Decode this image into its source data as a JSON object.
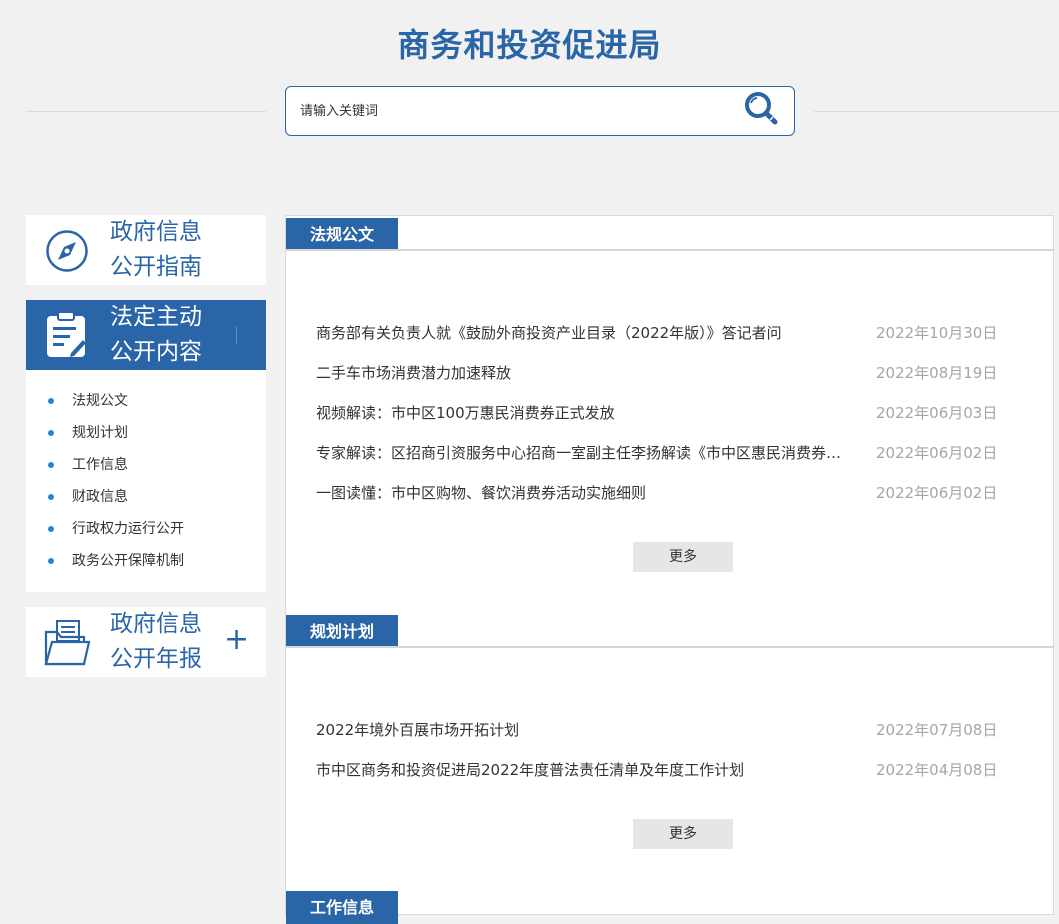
{
  "header": {
    "title": "商务和投资促进局"
  },
  "search": {
    "placeholder": "请输入关键词",
    "button_icon": "search-magnifier-icon"
  },
  "sidebar": {
    "guide": {
      "line1": "政府信息",
      "line2": "公开指南",
      "icon": "compass-icon"
    },
    "content": {
      "line1": "法定主动",
      "line2": "公开内容",
      "icon": "clipboard-icon"
    },
    "submenu": [
      {
        "label": "法规公文"
      },
      {
        "label": "规划计划"
      },
      {
        "label": "工作信息"
      },
      {
        "label": "财政信息"
      },
      {
        "label": "行政权力运行公开"
      },
      {
        "label": "政务公开保障机制"
      }
    ],
    "annual": {
      "line1": "政府信息",
      "line2": "公开年报",
      "icon": "folder-icon",
      "expand": "+"
    }
  },
  "sections": [
    {
      "tab": "法规公文",
      "items": [
        {
          "title": "商务部有关负责人就《鼓励外商投资产业目录（2022年版）》答记者问",
          "date": "2022年10月30日"
        },
        {
          "title": "二手车市场消费潜力加速释放",
          "date": "2022年08月19日"
        },
        {
          "title": "视频解读：市中区100万惠民消费券正式发放",
          "date": "2022年06月03日"
        },
        {
          "title": "专家解读：区招商引资服务中心招商一室副主任李扬解读《市中区惠民消费券活动实施细则》",
          "date": "2022年06月02日"
        },
        {
          "title": "一图读懂：市中区购物、餐饮消费券活动实施细则",
          "date": "2022年06月02日"
        }
      ],
      "more": "更多"
    },
    {
      "tab": "规划计划",
      "items": [
        {
          "title": "2022年境外百展市场开拓计划",
          "date": "2022年07月08日"
        },
        {
          "title": "市中区商务和投资促进局2022年度普法责任清单及年度工作计划",
          "date": "2022年04月08日"
        }
      ],
      "more": "更多"
    },
    {
      "tab": "工作信息"
    }
  ],
  "colors": {
    "accent": "#2a65a8",
    "background": "#f1f1f1",
    "date": "#a6a6a6",
    "bullet": "#2a85d8"
  }
}
